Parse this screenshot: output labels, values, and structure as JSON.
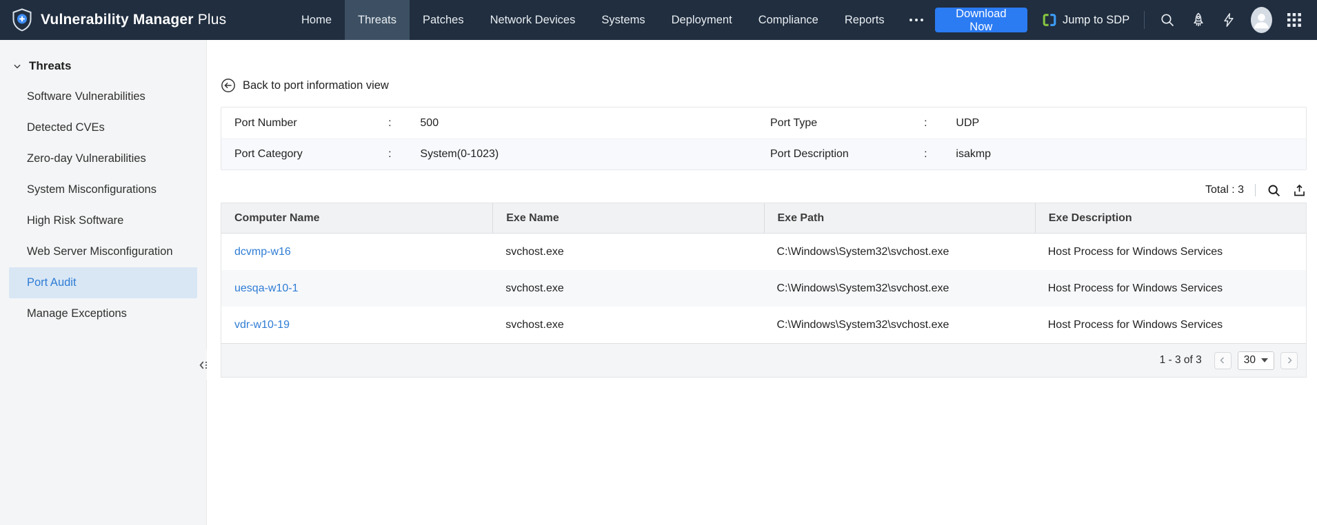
{
  "topbar": {
    "brand": {
      "name_bold": "Vulnerability Manager",
      "name_light": "Plus"
    },
    "nav": [
      {
        "label": "Home",
        "active": false
      },
      {
        "label": "Threats",
        "active": true
      },
      {
        "label": "Patches",
        "active": false
      },
      {
        "label": "Network Devices",
        "active": false
      },
      {
        "label": "Systems",
        "active": false
      },
      {
        "label": "Deployment",
        "active": false
      },
      {
        "label": "Compliance",
        "active": false
      },
      {
        "label": "Reports",
        "active": false
      }
    ],
    "download_button": "Download Now",
    "jump_to_sdp": "Jump to SDP"
  },
  "sidebar": {
    "header": "Threats",
    "items": [
      "Software Vulnerabilities",
      "Detected CVEs",
      "Zero-day Vulnerabilities",
      "System Misconfigurations",
      "High Risk Software",
      "Web Server Misconfiguration",
      "Port Audit",
      "Manage Exceptions"
    ],
    "active_item": "Port Audit"
  },
  "main": {
    "back_link": "Back to port information view",
    "port_info": {
      "colon": ":",
      "rows": [
        {
          "left_label": "Port Number",
          "left_value": "500",
          "right_label": "Port Type",
          "right_value": "UDP"
        },
        {
          "left_label": "Port Category",
          "left_value": "System(0-1023)",
          "right_label": "Port Description",
          "right_value": "isakmp"
        }
      ]
    },
    "total_label": "Total : 3",
    "table": {
      "columns": [
        "Computer Name",
        "Exe Name",
        "Exe Path",
        "Exe Description"
      ],
      "rows": [
        {
          "computer": "dcvmp-w16",
          "exe_name": "svchost.exe",
          "exe_path": "C:\\Windows\\System32\\svchost.exe",
          "exe_desc": "Host Process for Windows Services"
        },
        {
          "computer": "uesqa-w10-1",
          "exe_name": "svchost.exe",
          "exe_path": "C:\\Windows\\System32\\svchost.exe",
          "exe_desc": "Host Process for Windows Services"
        },
        {
          "computer": "vdr-w10-19",
          "exe_name": "svchost.exe",
          "exe_path": "C:\\Windows\\System32\\svchost.exe",
          "exe_desc": "Host Process for Windows Services"
        }
      ]
    },
    "pagination": {
      "range": "1 - 3 of 3",
      "page_size": "30"
    }
  },
  "colors": {
    "topbar_bg": "#202e3f",
    "active_tab_bg": "#3d5063",
    "accent_blue": "#2b7bf3",
    "link_blue": "#2e7cd4",
    "active_item_bg": "#d9e7f5",
    "sidebar_bg": "#f4f5f6",
    "sdp_green": "#84c341",
    "sdp_blue": "#3d9df6"
  }
}
